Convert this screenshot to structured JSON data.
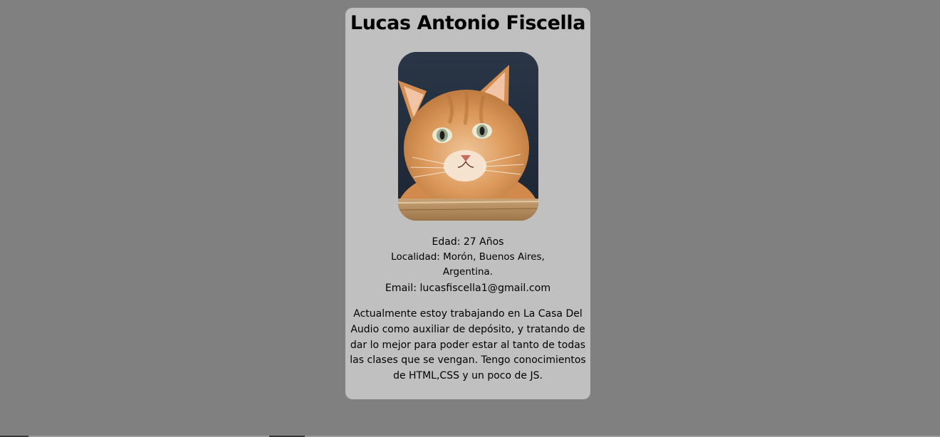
{
  "profile": {
    "name": "Lucas Antonio Fiscella",
    "photo_alt": "cat-photo",
    "age_line": "Edad: 27 Años",
    "location_line": "Localidad: Morón, Buenos Aires, Argentina.",
    "email_line": "Email: lucasfiscella1@gmail.com",
    "about": "Actualmente estoy trabajando en La Casa Del Audio como auxiliar de depósito, y tratando de dar lo mejor para poder estar al tanto de todas las clases que se vengan. Tengo conocimientos de HTML,CSS y un poco de JS."
  },
  "colors": {
    "page_background": "#808080",
    "card_background": "#c0c0c0",
    "text": "#000000"
  }
}
